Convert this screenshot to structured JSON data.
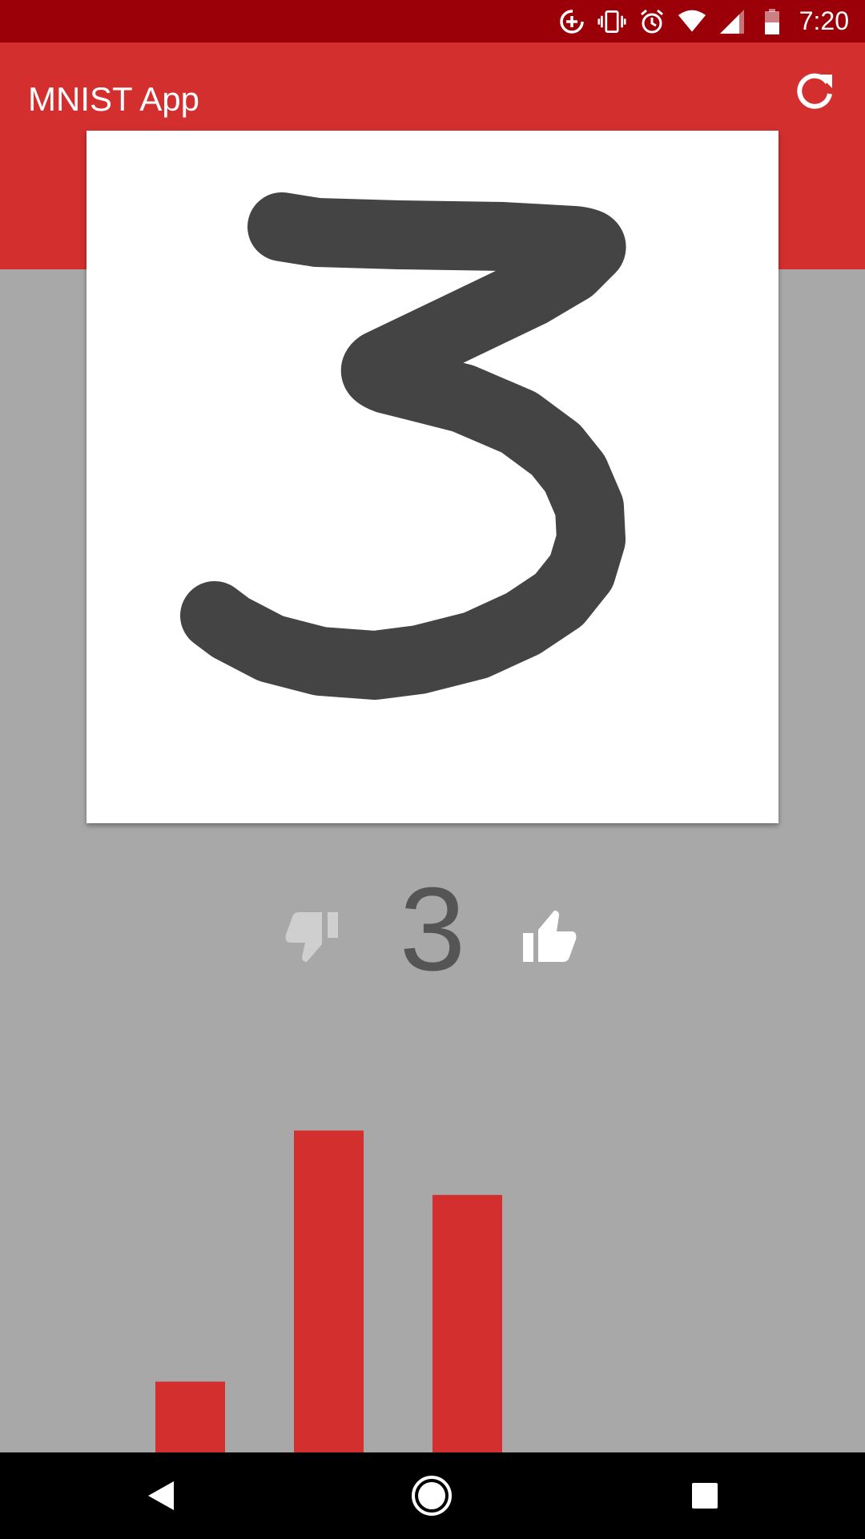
{
  "status_bar": {
    "time": "7:20",
    "icons": [
      "data-saver-icon",
      "vibrate-icon",
      "alarm-icon",
      "wifi-icon",
      "cell-signal-icon",
      "battery-icon"
    ]
  },
  "app_bar": {
    "title": "MNIST App",
    "refresh_icon": "refresh-icon",
    "color": "#d32f2f"
  },
  "drawing": {
    "stroke_color": "#444444",
    "background": "#ffffff"
  },
  "prediction": {
    "digit": "3",
    "thumb_down_icon": "thumb-down-icon",
    "thumb_up_icon": "thumb-up-icon"
  },
  "chart_data": {
    "type": "bar",
    "categories": [
      "",
      "",
      ""
    ],
    "values": [
      0.22,
      1.0,
      0.8
    ],
    "ylim": [
      0,
      1.3
    ],
    "bar_color": "#d32f2f",
    "grid": false
  },
  "nav_bar": {
    "back_icon": "back-icon",
    "home_icon": "home-icon",
    "recents_icon": "recents-icon"
  }
}
